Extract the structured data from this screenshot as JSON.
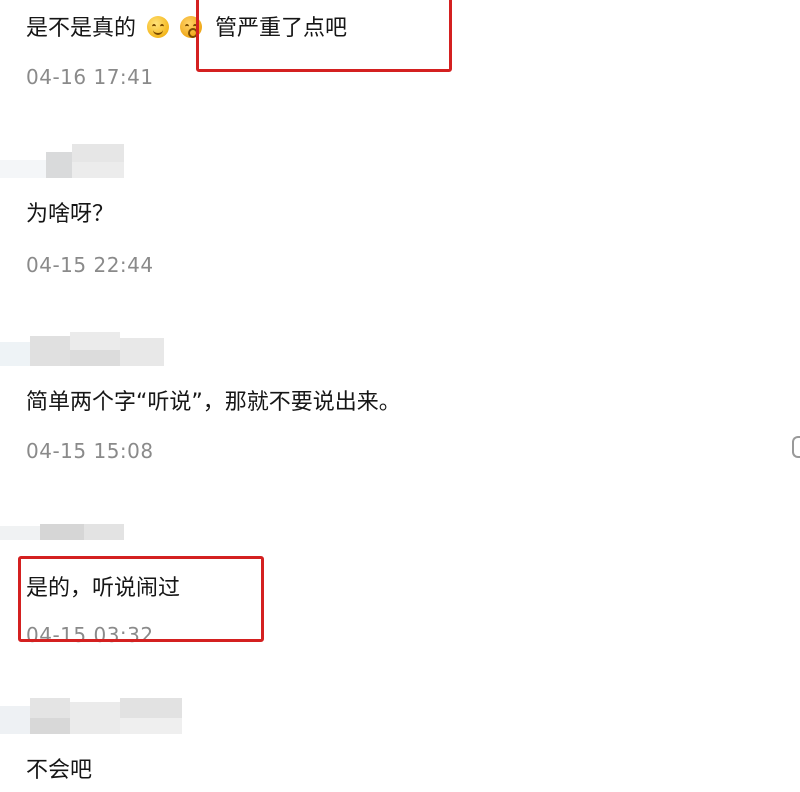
{
  "comments": [
    {
      "text": "是不是真的",
      "text_after": "管严重了点吧",
      "time": "04-16 17:41",
      "emojis": [
        "smile-emoji",
        "grin-emoji"
      ]
    },
    {
      "text": "为啥呀？",
      "time": "04-15 22:44"
    },
    {
      "text": "简单两个字“听说”，那就不要说出来。",
      "time": "04-15 15:08"
    },
    {
      "text": "是的，听说闹过",
      "time": "04-15 03:32"
    },
    {
      "text": "不会吧",
      "time": ""
    }
  ],
  "colors": {
    "highlight": "#d42020",
    "timestamp": "#8a8a8a",
    "text": "#161616"
  }
}
